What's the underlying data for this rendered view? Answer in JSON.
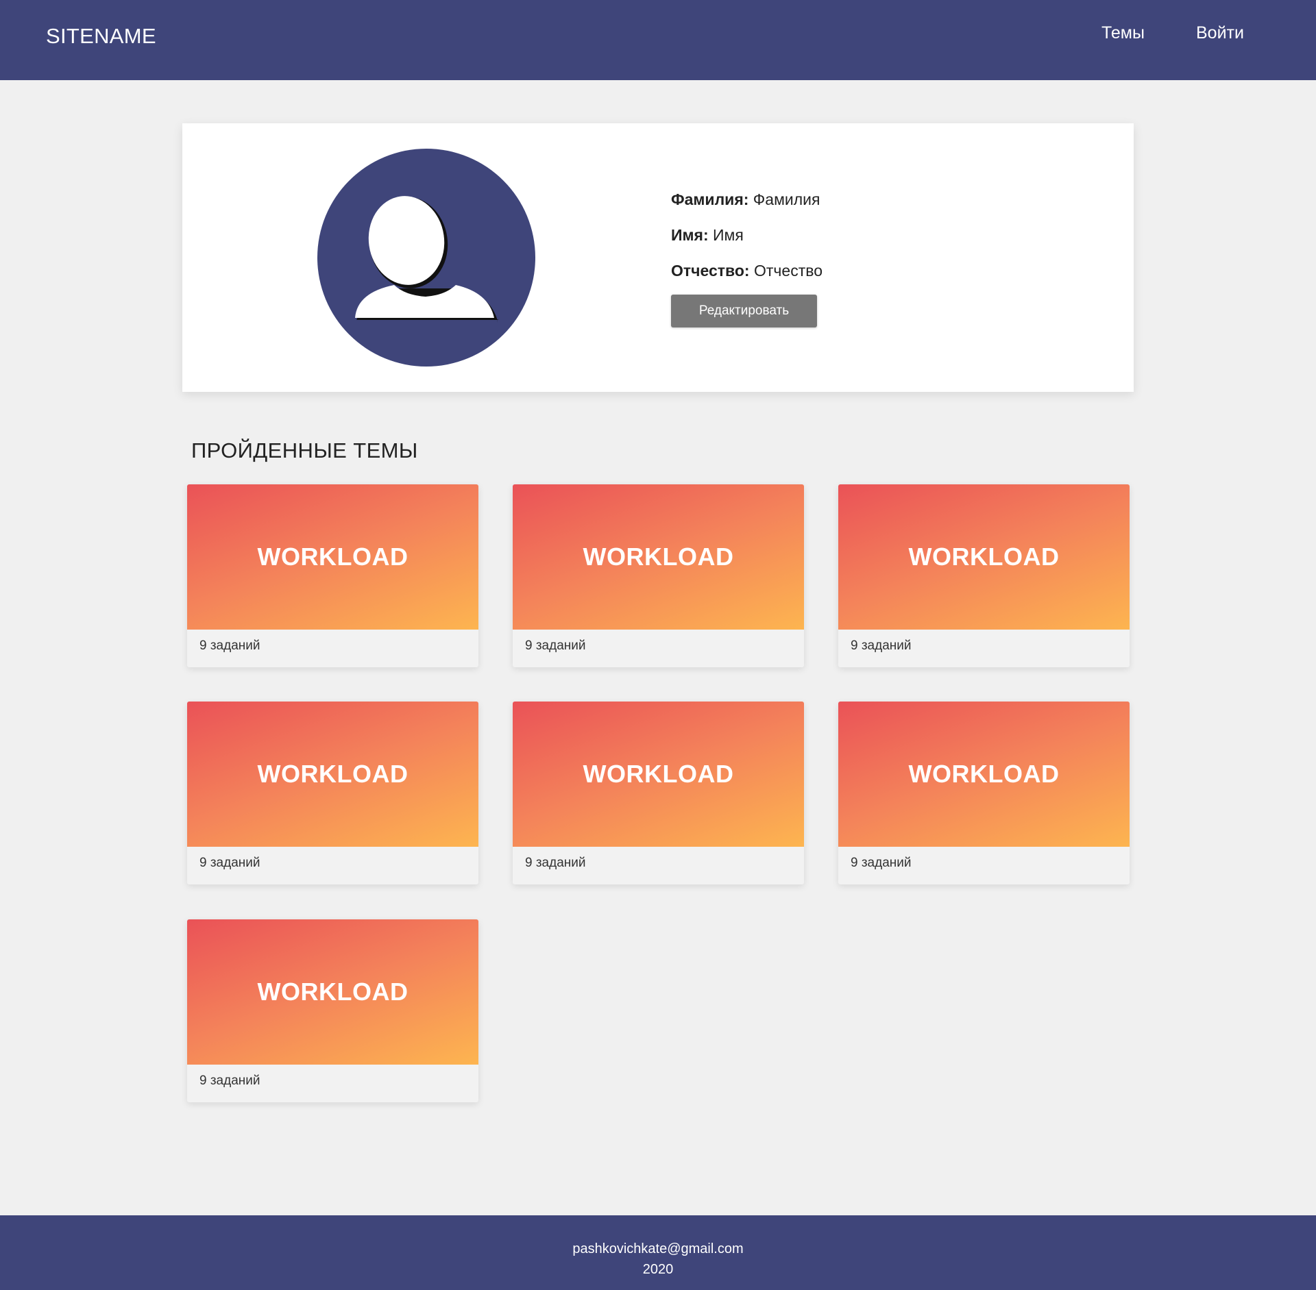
{
  "header": {
    "logo": "SITENAME",
    "nav": {
      "themes": "Темы",
      "login": "Войти"
    },
    "bg_color": "#3f457a"
  },
  "profile": {
    "avatar_icon": "user-silhouette-icon",
    "fields": [
      {
        "label": "Фамилия:",
        "value": "Фамилия"
      },
      {
        "label": "Имя:",
        "value": "Имя"
      },
      {
        "label": "Отчество:",
        "value": "Отчество"
      }
    ],
    "edit_button": "Редактировать"
  },
  "section_title": "ПРОЙДЕННЫЕ ТЕМЫ",
  "topics": [
    {
      "title": "WORKLOAD",
      "tasks": "9 заданий"
    },
    {
      "title": "WORKLOAD",
      "tasks": "9 заданий"
    },
    {
      "title": "WORKLOAD",
      "tasks": "9 заданий"
    },
    {
      "title": "WORKLOAD",
      "tasks": "9 заданий"
    },
    {
      "title": "WORKLOAD",
      "tasks": "9 заданий"
    },
    {
      "title": "WORKLOAD",
      "tasks": "9 заданий"
    },
    {
      "title": "WORKLOAD",
      "tasks": "9 заданий"
    }
  ],
  "footer": {
    "email": "pashkovichkate@gmail.com",
    "year": "2020"
  },
  "colors": {
    "accent": "#3f457a",
    "card_gradient": [
      "#ea5257",
      "#fdb550"
    ],
    "button": "#777777"
  }
}
